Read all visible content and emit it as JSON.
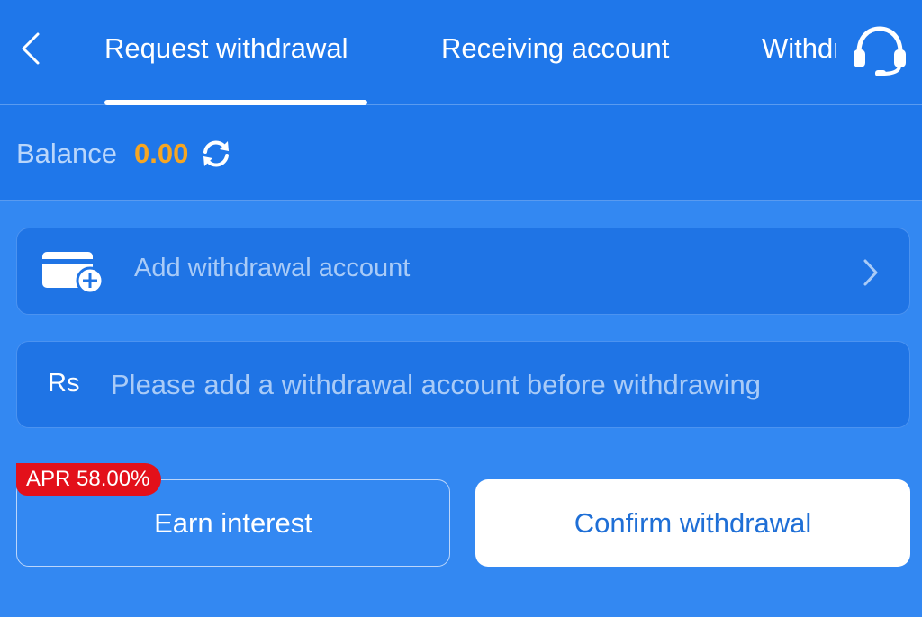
{
  "header": {
    "back_icon": "chevron-left-icon",
    "tabs": [
      {
        "label": "Request withdrawal",
        "active": true
      },
      {
        "label": "Receiving account",
        "active": false
      },
      {
        "label": "Withdrawal history",
        "active": false
      }
    ],
    "support_icon": "headset-icon"
  },
  "balance": {
    "label": "Balance",
    "value": "0.00",
    "refresh_icon": "refresh-icon"
  },
  "account": {
    "icon": "wallet-add-icon",
    "label": "Add withdrawal account",
    "chevron_icon": "chevron-right-icon"
  },
  "amount": {
    "currency": "Rs",
    "value": "",
    "placeholder": "Please add a withdrawal account before withdrawing"
  },
  "actions": {
    "apr_badge": "APR 58.00%",
    "earn_label": "Earn interest",
    "confirm_label": "Confirm withdrawal"
  },
  "colors": {
    "page_background": "#3388f2",
    "header_background": "#1f77ea",
    "balance_value": "#f6a623",
    "apr_badge": "#e3101a",
    "confirm_text": "#1f6fd6"
  }
}
